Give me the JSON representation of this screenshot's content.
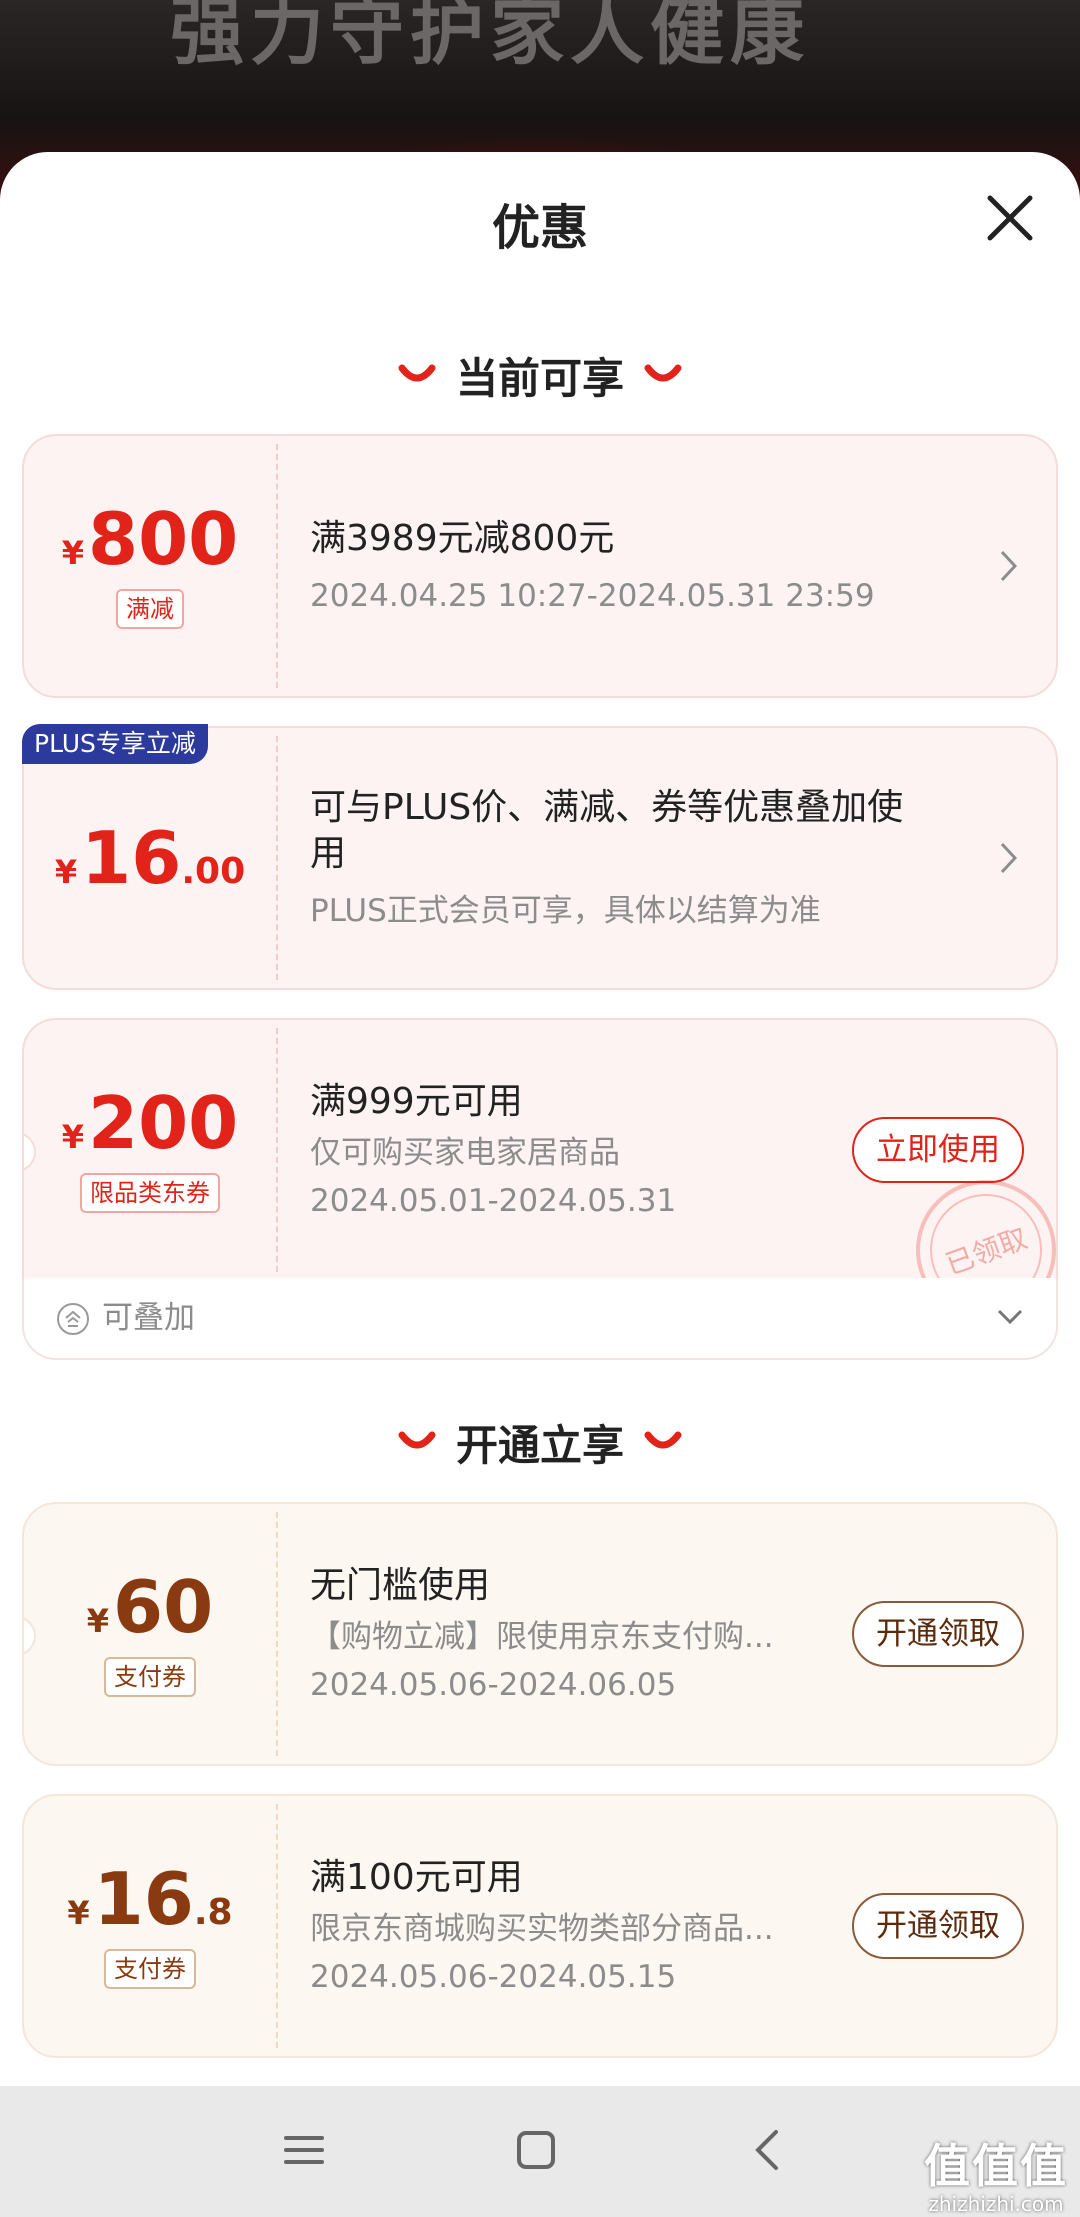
{
  "header": {
    "title": "优惠"
  },
  "sections": {
    "current": "当前可享",
    "activate": "开通立享"
  },
  "coupons": [
    {
      "yen": "¥",
      "amount_big": "800",
      "amount_small": "",
      "tag": "满减",
      "title": "满3989元减800元",
      "line1": "2024.04.25 10:27-2024.05.31 23:59",
      "line2": ""
    },
    {
      "badge": "PLUS专享立减",
      "yen": "¥",
      "amount_big": "16",
      "amount_small": ".00",
      "tag": "",
      "title": "可与PLUS价、满减、券等优惠叠加使用",
      "line1": "PLUS正式会员可享，具体以结算为准",
      "line2": ""
    },
    {
      "yen": "¥",
      "amount_big": "200",
      "amount_small": "",
      "tag": "限品类东券",
      "title": "满999元可用",
      "line1": "仅可购买家电家居商品",
      "line2": "2024.05.01-2024.05.31",
      "button": "立即使用",
      "stamp": "已领取",
      "footer": "可叠加"
    },
    {
      "yen": "¥",
      "amount_big": "60",
      "amount_small": "",
      "tag": "支付券",
      "title": "无门槛使用",
      "line1": "【购物立减】限使用京东支付购...",
      "line2": "2024.05.06-2024.06.05",
      "button": "开通领取"
    },
    {
      "yen": "¥",
      "amount_big": "16",
      "amount_small": ".8",
      "tag": "支付券",
      "title": "满100元可用",
      "line1": "限京东商城购买实物类部分商品...",
      "line2": "2024.05.06-2024.05.15",
      "button": "开通领取"
    }
  ],
  "watermark": {
    "cn": "值值值",
    "url": "zhizhizhi.com"
  },
  "colors": {
    "accent": "#e2231a",
    "plus_badge": "#2c3a9e",
    "gold_text": "#8a3a10"
  },
  "icons": [
    "close-icon",
    "chevron-right-icon",
    "stack-icon",
    "chevron-down-icon",
    "menu-icon",
    "home-square-icon",
    "back-icon"
  ]
}
